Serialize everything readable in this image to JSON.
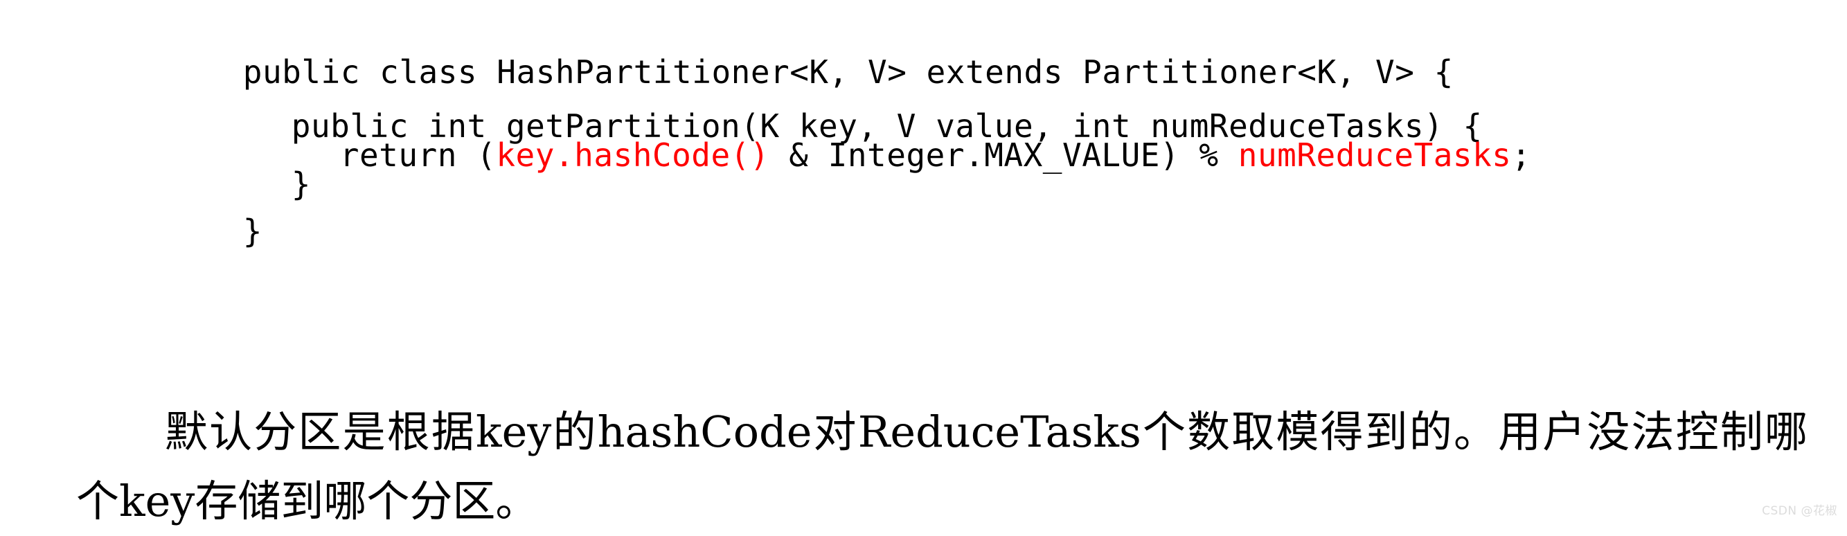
{
  "colors": {
    "background": "#ffffff",
    "code_text": "#000000",
    "code_highlight": "#ff0000",
    "prose_text": "#000000",
    "watermark": "#dcdcdc"
  },
  "code": {
    "language": "java",
    "lines": [
      {
        "id": "class-declaration",
        "indent": 0,
        "segments": [
          {
            "text": "public class HashPartitioner<K, V> extends Partitioner<K, V> {",
            "color": "black"
          }
        ],
        "plain": "public class HashPartitioner<K, V> extends Partitioner<K, V> {"
      },
      {
        "id": "blank-1",
        "indent": 0,
        "segments": [],
        "plain": ""
      },
      {
        "id": "method-signature",
        "indent": 1,
        "segments": [
          {
            "text": "public int getPartition(K key, V value, int numReduceTasks) {",
            "color": "black"
          }
        ],
        "plain": "public int getPartition(K key, V value, int numReduceTasks) {"
      },
      {
        "id": "return-statement",
        "indent": 2,
        "segments": [
          {
            "text": "return (",
            "color": "black"
          },
          {
            "text": "key.hashCode()",
            "color": "red"
          },
          {
            "text": " & Integer.MAX_VALUE) % ",
            "color": "black"
          },
          {
            "text": "numReduceTasks",
            "color": "red"
          },
          {
            "text": ";",
            "color": "black"
          }
        ],
        "plain": "return (key.hashCode() & Integer.MAX_VALUE) % numReduceTasks;"
      },
      {
        "id": "method-close-brace",
        "indent": 1,
        "segments": [
          {
            "text": "}",
            "color": "black"
          }
        ],
        "plain": "}"
      },
      {
        "id": "blank-2",
        "indent": 0,
        "segments": [],
        "plain": ""
      },
      {
        "id": "class-close-brace",
        "indent": 0,
        "segments": [
          {
            "text": "}",
            "color": "black"
          }
        ],
        "plain": "}"
      }
    ],
    "line_class": "public class HashPartitioner<K, V> extends Partitioner<K, V> {",
    "line_method": "public int getPartition(K key, V value, int numReduceTasks) {",
    "return_prefix": "return (",
    "return_red_1": "key.hashCode()",
    "return_middle": " & Integer.MAX_VALUE) % ",
    "return_red_2": "numReduceTasks",
    "return_suffix": ";",
    "brace_method": "}",
    "brace_class": "}"
  },
  "prose": {
    "full_text": "默认分区是根据key的hashCode对ReduceTasks个数取模得到的。用户没法控制哪个key存储到哪个分区。",
    "parts": [
      {
        "script": "cjk",
        "text": "默认分区是根据"
      },
      {
        "script": "latin",
        "text": "key"
      },
      {
        "script": "cjk",
        "text": "的"
      },
      {
        "script": "latin",
        "text": "hashCode"
      },
      {
        "script": "cjk",
        "text": "对"
      },
      {
        "script": "latin",
        "text": "ReduceTasks"
      },
      {
        "script": "cjk",
        "text": "个数取模得到的。用户没法控制哪个"
      },
      {
        "script": "latin",
        "text": "key"
      },
      {
        "script": "cjk",
        "text": "存储到哪个分区。"
      }
    ],
    "seg_1": "默认分区是根据",
    "seg_2": "key",
    "seg_3": "的",
    "seg_4": "hashCode",
    "seg_5": "对",
    "seg_6": "ReduceTasks",
    "seg_7": "个数取模得到的。用户没法控制哪个",
    "seg_8": "key",
    "seg_9": "存储到哪个分区。"
  },
  "watermark": {
    "text": "CSDN @花椒"
  }
}
